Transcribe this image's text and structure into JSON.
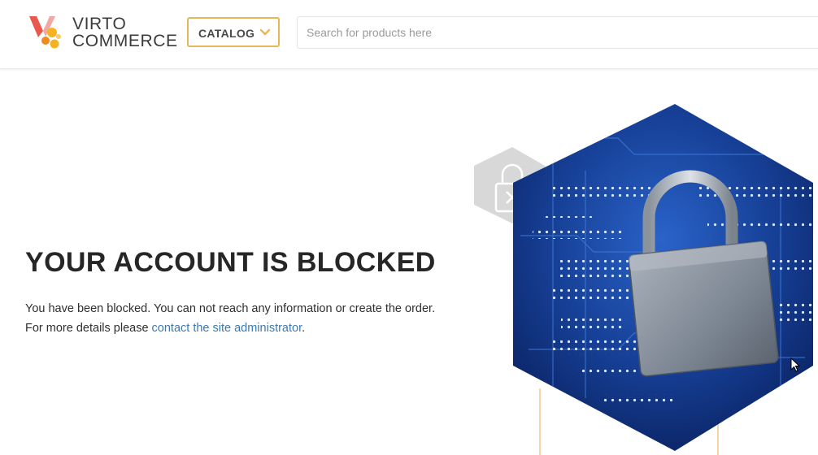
{
  "header": {
    "logo": {
      "line1": "VIRTO",
      "line2": "COMMERCE"
    },
    "catalog_label": "CATALOG",
    "search_placeholder": "Search for products here"
  },
  "main": {
    "title": "YOUR ACCOUNT IS BLOCKED",
    "message_line1": "You have been blocked. You can not reach any information or create the order.",
    "message_line2_prefix": "For more details please ",
    "message_link": "contact the site administrator",
    "message_line2_suffix": "."
  },
  "icons": {
    "logo": "virto-logo-icon",
    "catalog_chevron": "chevron-down-icon",
    "small_hexagon": "padlock-x-icon",
    "large_hexagon": "padlock-circuit-image"
  },
  "colors": {
    "accent": "#e8b65a",
    "link": "#3a79b5",
    "text": "#262626",
    "circuit_blue": "#123b8a"
  }
}
